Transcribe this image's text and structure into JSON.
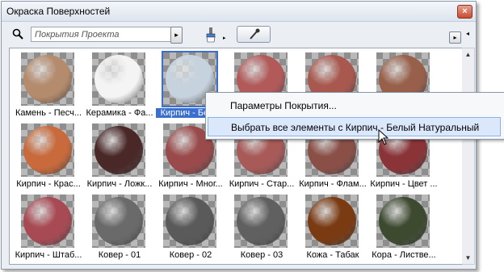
{
  "window": {
    "title": "Окраска Поверхностей",
    "close_glyph": "×"
  },
  "toolbar": {
    "search_placeholder": "Покрытия Проекта",
    "search_go_glyph": "▸",
    "brush_arrow_glyph": "▸",
    "panel_menu_glyph": "▸",
    "collapse_glyph": "◂"
  },
  "scrollbar": {
    "up_glyph": "▲",
    "down_glyph": "▼"
  },
  "materials": [
    {
      "label": "Камень - Песч...",
      "color": "#b48b6c",
      "selected": false
    },
    {
      "label": "Керамика - Фа...",
      "color": "#f4f4f4",
      "selected": false
    },
    {
      "label": "Кирпич - Бел...",
      "color": "#c6d2de",
      "selected": true
    },
    {
      "label": "",
      "color": "#b25a5a",
      "selected": false
    },
    {
      "label": "",
      "color": "#a8584e",
      "selected": false
    },
    {
      "label": "",
      "color": "#98604a",
      "selected": false
    },
    {
      "label": "Кирпич - Крас...",
      "color": "#c86a3c",
      "selected": false
    },
    {
      "label": "Кирпич - Ложк...",
      "color": "#4a2828",
      "selected": false
    },
    {
      "label": "Кирпич - Мног...",
      "color": "#9a4a4a",
      "selected": false
    },
    {
      "label": "Кирпич - Стар...",
      "color": "#a85a58",
      "selected": false
    },
    {
      "label": "Кирпич - Флам...",
      "color": "#8a5048",
      "selected": false
    },
    {
      "label": "Кирпич - Цвет ...",
      "color": "#8a3438",
      "selected": false
    },
    {
      "label": "Кирпич - Штаб...",
      "color": "#a84a54",
      "selected": false
    },
    {
      "label": "Ковер - 01",
      "color": "#6a6a6a",
      "selected": false
    },
    {
      "label": "Ковер - 02",
      "color": "#5a5a5a",
      "selected": false
    },
    {
      "label": "Ковер - 03",
      "color": "#606060",
      "selected": false
    },
    {
      "label": "Кожа - Табак",
      "color": "#7a3a12",
      "selected": false
    },
    {
      "label": "Кора - Листве...",
      "color": "#3e4a30",
      "selected": false
    }
  ],
  "context_menu": {
    "items": [
      {
        "label": "Параметры Покрытия...",
        "highlighted": false
      },
      {
        "label": "Выбрать все элементы с Кирпич - Белый Натуральный",
        "highlighted": true
      }
    ]
  },
  "colors": {
    "selection": "#3a6fd0",
    "menu_highlight": "#dbe8fb"
  }
}
